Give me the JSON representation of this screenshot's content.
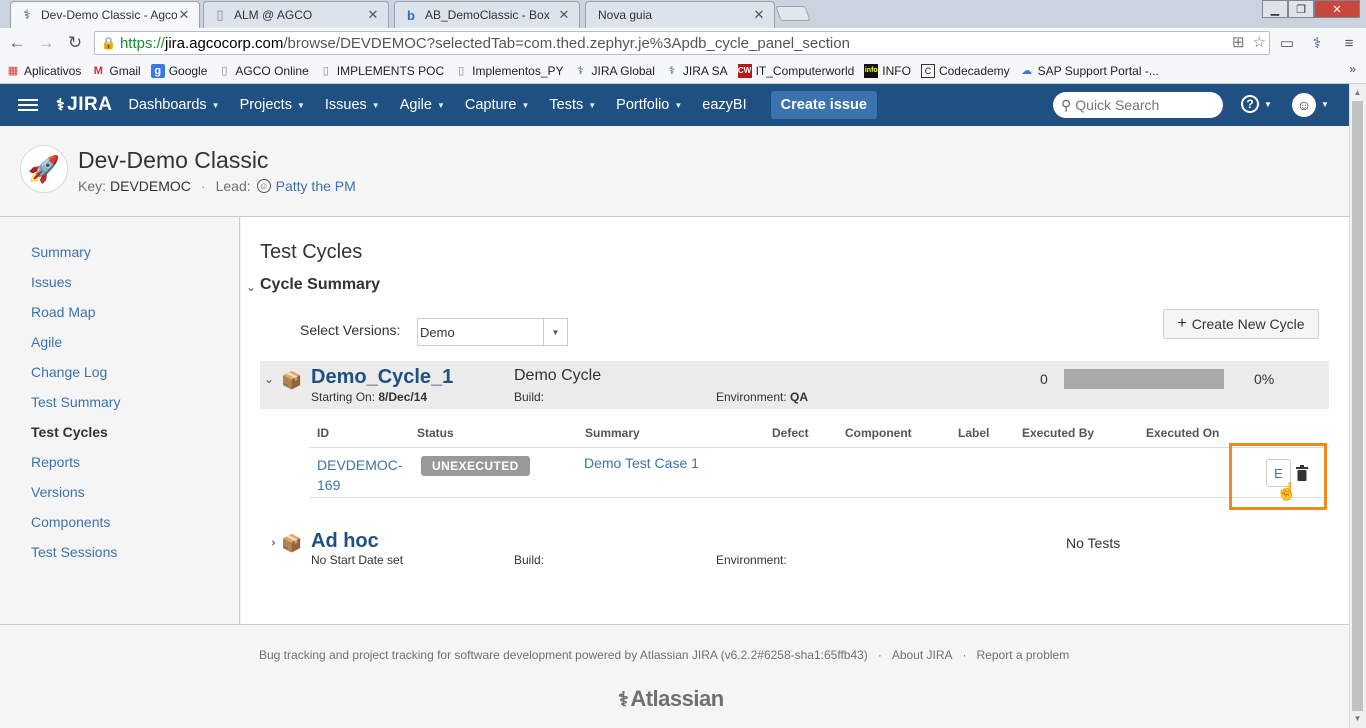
{
  "browser": {
    "tabs": [
      {
        "label": "Dev-Demo Classic - Agco",
        "icon": "jira-icon",
        "active": true
      },
      {
        "label": "ALM @ AGCO",
        "icon": "page-icon",
        "active": false
      },
      {
        "label": "AB_DemoClassic - Box",
        "icon": "box-icon",
        "active": false
      },
      {
        "label": "Nova guia",
        "icon": "",
        "active": false
      }
    ],
    "url_scheme": "https://",
    "url_host": "jira.agcocorp.com",
    "url_path": "/browse/DEVDEMOC?selectedTab=com.thed.zephyr.je%3Apdb_cycle_panel_section",
    "bookmarks": [
      {
        "label": "Aplicativos",
        "icon": "apps-grid-icon"
      },
      {
        "label": "Gmail",
        "icon": "gmail-icon"
      },
      {
        "label": "Google",
        "icon": "google-icon"
      },
      {
        "label": "AGCO Online",
        "icon": "page-icon"
      },
      {
        "label": "IMPLEMENTS POC",
        "icon": "page-icon"
      },
      {
        "label": "Implementos_PY",
        "icon": "page-icon"
      },
      {
        "label": "JIRA Global",
        "icon": "jira-icon"
      },
      {
        "label": "JIRA SA",
        "icon": "jira-icon"
      },
      {
        "label": "IT_Computerworld",
        "icon": "cw-icon"
      },
      {
        "label": "INFO",
        "icon": "info-icon"
      },
      {
        "label": "Codecademy",
        "icon": "codecademy-icon"
      },
      {
        "label": "SAP Support Portal -...",
        "icon": "sap-icon"
      }
    ],
    "bookmarks_more": "»"
  },
  "jira_header": {
    "logo": "JIRA",
    "menu": [
      "Dashboards",
      "Projects",
      "Issues",
      "Agile",
      "Capture",
      "Tests",
      "Portfolio"
    ],
    "eazybi": "eazyBI",
    "create_issue": "Create issue",
    "search_placeholder": "Quick Search",
    "help": "?"
  },
  "project": {
    "name": "Dev-Demo Classic",
    "key_label": "Key:",
    "key": "DEVDEMOC",
    "lead_label": "Lead:",
    "lead": "Patty the PM"
  },
  "sidebar": {
    "items": [
      {
        "label": "Summary",
        "selected": false
      },
      {
        "label": "Issues",
        "selected": false
      },
      {
        "label": "Road Map",
        "selected": false
      },
      {
        "label": "Agile",
        "selected": false
      },
      {
        "label": "Change Log",
        "selected": false
      },
      {
        "label": "Test Summary",
        "selected": false
      },
      {
        "label": "Test Cycles",
        "selected": true
      },
      {
        "label": "Reports",
        "selected": false
      },
      {
        "label": "Versions",
        "selected": false
      },
      {
        "label": "Components",
        "selected": false
      },
      {
        "label": "Test Sessions",
        "selected": false
      }
    ]
  },
  "main": {
    "title": "Test Cycles",
    "section": "Cycle Summary",
    "select_versions_label": "Select Versions:",
    "select_versions_value": "Demo",
    "create_new_cycle": "Create New Cycle",
    "cycles": [
      {
        "name": "Demo_Cycle_1",
        "start_label": "Starting On:",
        "start_date": "8/Dec/14",
        "description": "Demo Cycle",
        "build_label": "Build:",
        "build": "",
        "env_label": "Environment:",
        "env": "QA",
        "executed_count": "0",
        "progress_percent": "0%",
        "progress_fraction": 0
      },
      {
        "name": "Ad hoc",
        "start_label": "No Start Date set",
        "build_label": "Build:",
        "env_label": "Environment:",
        "no_tests": "No Tests"
      }
    ],
    "table": {
      "columns": [
        "ID",
        "Status",
        "Summary",
        "Defect",
        "Component",
        "Label",
        "Executed By",
        "Executed On"
      ],
      "rows": [
        {
          "id_line1": "DEVDEMOC-",
          "id_line2": "169",
          "status": "UNEXECUTED",
          "summary": "Demo Test Case 1",
          "edit_label": "E"
        }
      ]
    }
  },
  "footer": {
    "text": "Bug tracking and project tracking for software development powered by Atlassian JIRA (v6.2.2#6258-sha1:65ffb43)",
    "sep": "·",
    "about": "About JIRA",
    "report": "Report a problem",
    "logo": "Atlassian"
  },
  "colors": {
    "jira_blue": "#205081",
    "link_blue": "#3b73af",
    "highlight_orange": "#f0891e",
    "status_gray": "#999999"
  }
}
